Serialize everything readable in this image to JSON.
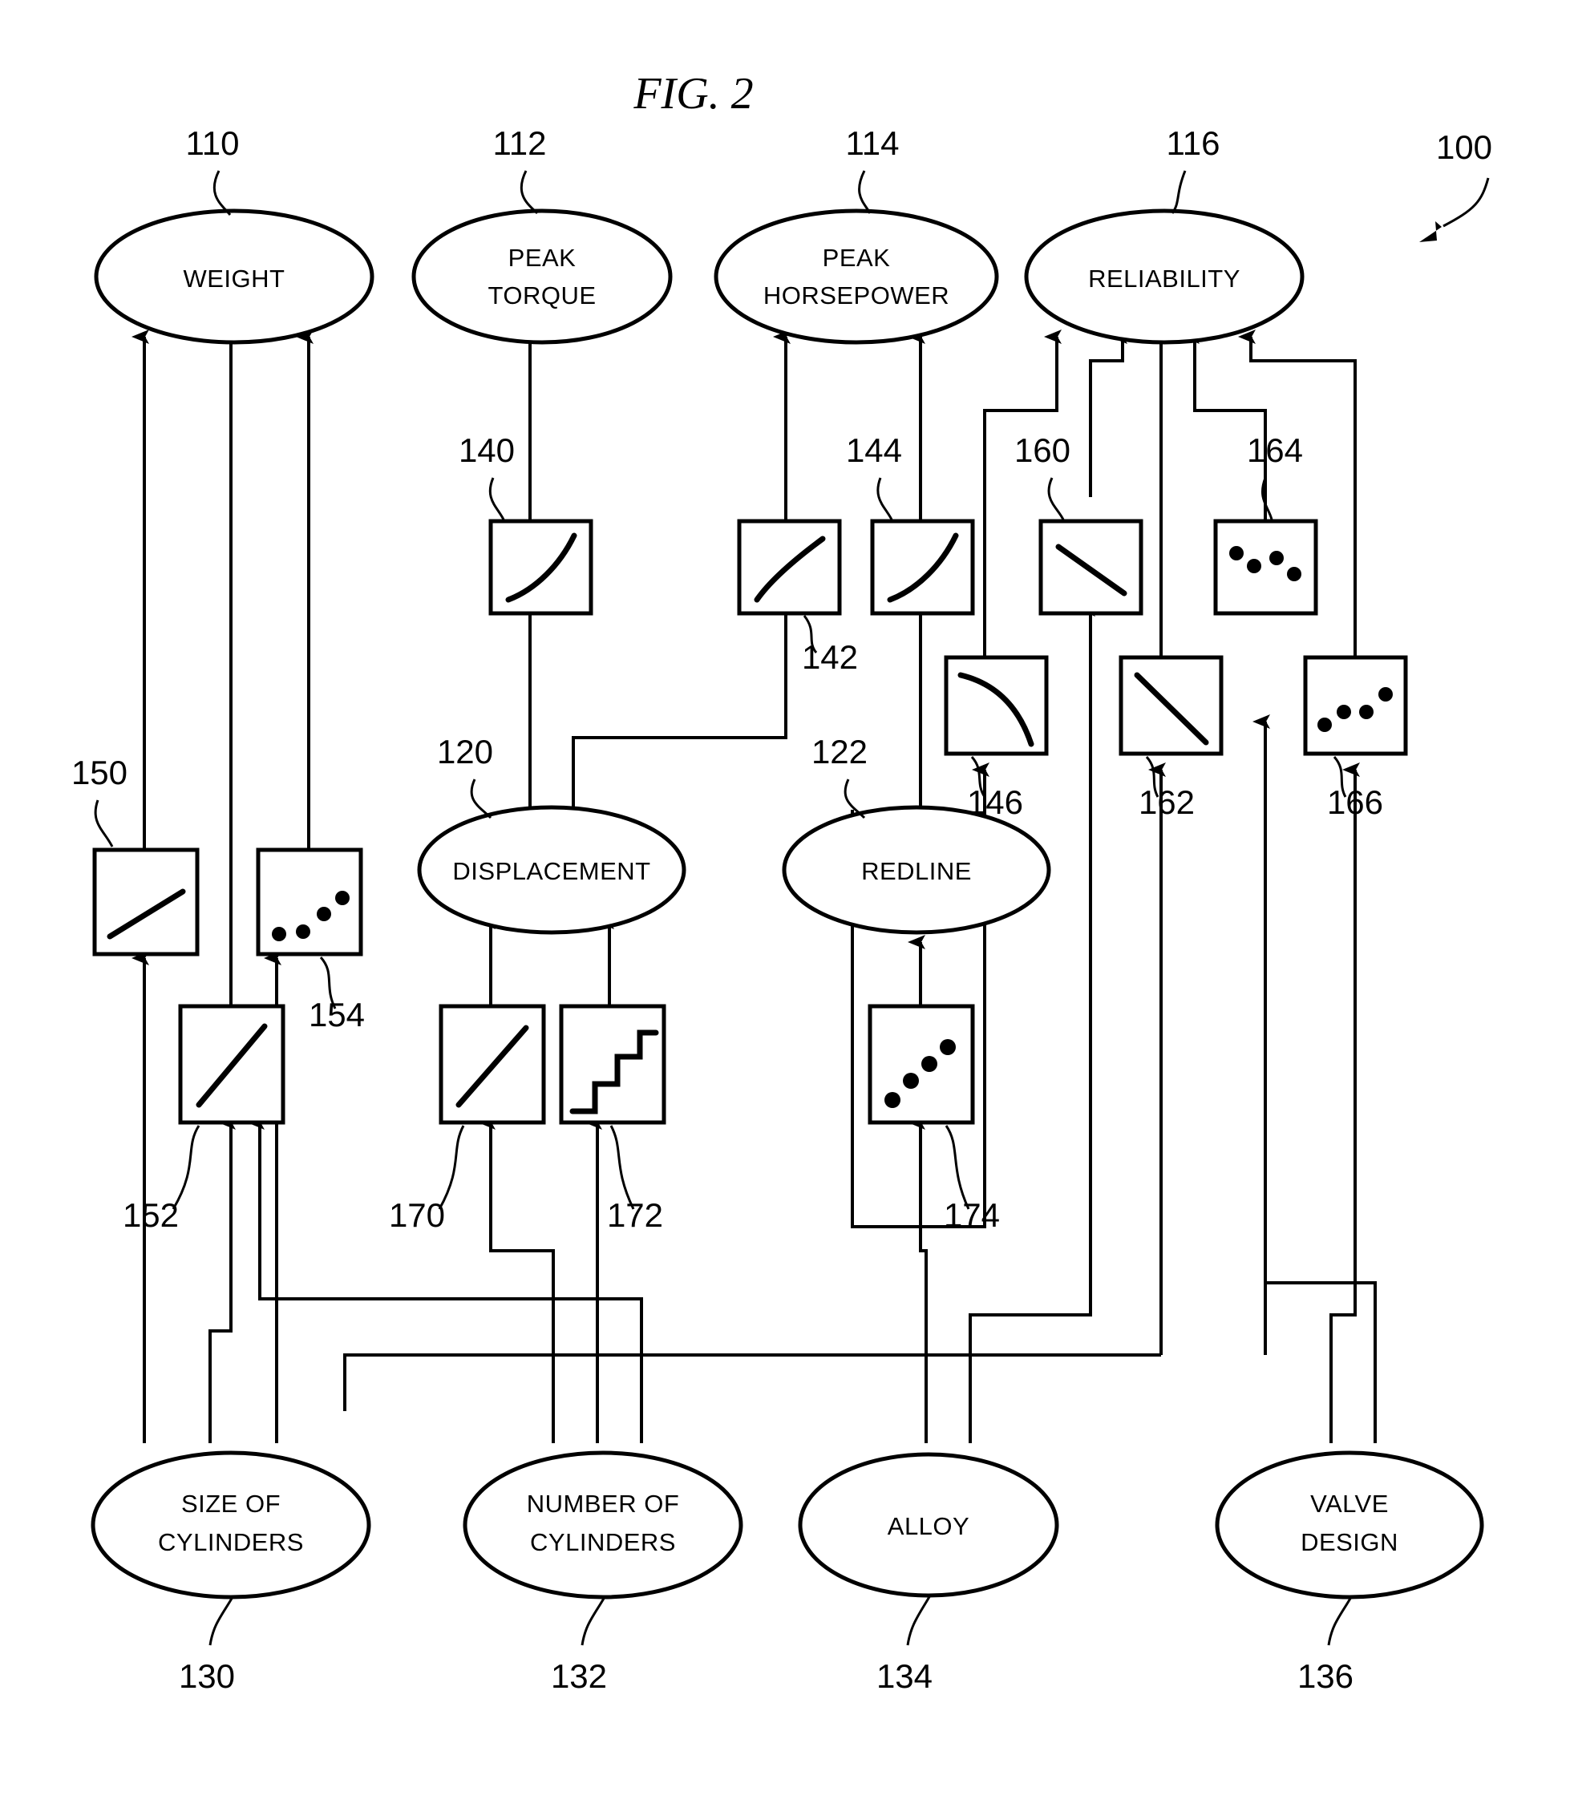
{
  "figure": {
    "title": "FIG. 2",
    "system_ref": "100"
  },
  "output_nodes": [
    {
      "id": "weight",
      "label_lines": [
        "WEIGHT"
      ],
      "ref": "110"
    },
    {
      "id": "peak-torque",
      "label_lines": [
        "PEAK",
        "TORQUE"
      ],
      "ref": "112"
    },
    {
      "id": "peak-horsepower",
      "label_lines": [
        "PEAK",
        "HORSEPOWER"
      ],
      "ref": "114"
    },
    {
      "id": "reliability",
      "label_lines": [
        "RELIABILITY"
      ],
      "ref": "116"
    }
  ],
  "intermediate_nodes": [
    {
      "id": "displacement",
      "label_lines": [
        "DISPLACEMENT"
      ],
      "ref": "120"
    },
    {
      "id": "redline",
      "label_lines": [
        "REDLINE"
      ],
      "ref": "122"
    }
  ],
  "input_nodes": [
    {
      "id": "size-of-cylinders",
      "label_lines": [
        "SIZE OF",
        "CYLINDERS"
      ],
      "ref": "130"
    },
    {
      "id": "number-of-cylinders",
      "label_lines": [
        "NUMBER OF",
        "CYLINDERS"
      ],
      "ref": "132"
    },
    {
      "id": "alloy",
      "label_lines": [
        "ALLOY"
      ],
      "ref": "134"
    },
    {
      "id": "valve-design",
      "label_lines": [
        "VALVE",
        "DESIGN"
      ],
      "ref": "136"
    }
  ],
  "transfer_boxes": [
    {
      "id": "tf-140",
      "ref": "140",
      "curve": "log-rising"
    },
    {
      "id": "tf-142",
      "ref": "142",
      "curve": "linear-rising-s"
    },
    {
      "id": "tf-144",
      "ref": "144",
      "curve": "log-rising"
    },
    {
      "id": "tf-146",
      "ref": "146",
      "curve": "concave-falling"
    },
    {
      "id": "tf-150",
      "ref": "150",
      "curve": "shallow-rising-line"
    },
    {
      "id": "tf-152",
      "ref": "152",
      "curve": "steep-rising-line"
    },
    {
      "id": "tf-154",
      "ref": "154",
      "curve": "scatter-rising"
    },
    {
      "id": "tf-160",
      "ref": "160",
      "curve": "falling-line"
    },
    {
      "id": "tf-162",
      "ref": "162",
      "curve": "falling-line"
    },
    {
      "id": "tf-164",
      "ref": "164",
      "curve": "scatter-falling"
    },
    {
      "id": "tf-166",
      "ref": "166",
      "curve": "scatter-rising"
    },
    {
      "id": "tf-170",
      "ref": "170",
      "curve": "steep-rising-line"
    },
    {
      "id": "tf-172",
      "ref": "172",
      "curve": "staircase"
    },
    {
      "id": "tf-174",
      "ref": "174",
      "curve": "scatter-rising"
    }
  ],
  "colors": {
    "ink": "#000000",
    "paper": "#ffffff"
  }
}
